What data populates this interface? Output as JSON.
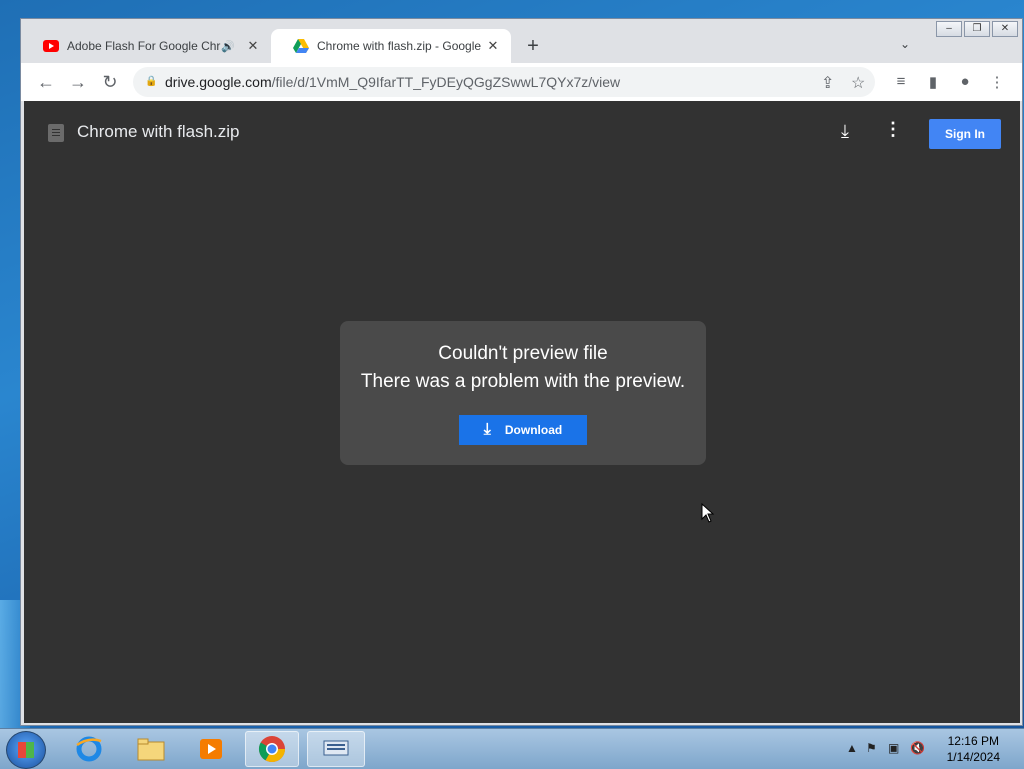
{
  "browser": {
    "tabs": [
      {
        "title": "Adobe Flash For Google Chr",
        "active": false,
        "favicon": "youtube-icon",
        "audio": true
      },
      {
        "title": "Chrome with flash.zip - Google D",
        "active": true,
        "favicon": "google-drive-icon"
      }
    ],
    "address": {
      "domain": "drive.google.com",
      "path": "/file/d/1VmM_Q9IfarTT_FyDEyQGgZSwwL7QYx7z/view"
    }
  },
  "viewer": {
    "file_name": "Chrome with flash.zip",
    "sign_in_label": "Sign In",
    "dialog": {
      "line1": "Couldn't preview file",
      "line2": "There was a problem with the preview.",
      "download_label": "Download"
    }
  },
  "taskbar": {
    "time": "12:16 PM",
    "date": "1/14/2024"
  },
  "colors": {
    "drive_bg": "#323232",
    "dialog_bg": "#4a4a4a",
    "primary_blue": "#1a73e8",
    "signin_blue": "#4285f4"
  }
}
